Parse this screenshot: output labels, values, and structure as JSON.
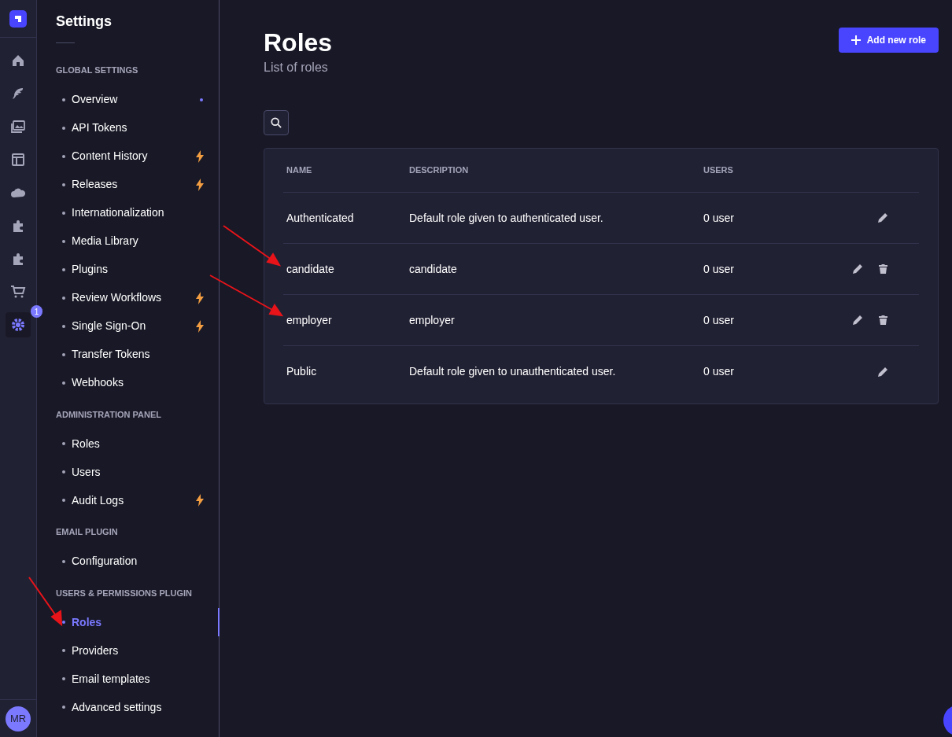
{
  "rail": {
    "items": [
      {
        "selected": false
      },
      {
        "selected": false
      },
      {
        "selected": false
      },
      {
        "selected": false
      },
      {
        "selected": false
      },
      {
        "selected": false
      },
      {
        "selected": false
      },
      {
        "selected": false
      },
      {
        "selected": true,
        "badge": "1"
      }
    ],
    "avatar": "MR"
  },
  "sidebar": {
    "title": "Settings",
    "sections": [
      {
        "heading": "GLOBAL SETTINGS",
        "items": [
          {
            "label": "Overview",
            "selected": false,
            "kind": "new"
          },
          {
            "label": "API Tokens",
            "selected": false
          },
          {
            "label": "Content History",
            "selected": false,
            "kind": "premium"
          },
          {
            "label": "Releases",
            "selected": false,
            "kind": "premium"
          },
          {
            "label": "Internationalization",
            "selected": false
          },
          {
            "label": "Media Library",
            "selected": false
          },
          {
            "label": "Plugins",
            "selected": false
          },
          {
            "label": "Review Workflows",
            "selected": false,
            "kind": "premium"
          },
          {
            "label": "Single Sign-On",
            "selected": false,
            "kind": "premium"
          },
          {
            "label": "Transfer Tokens",
            "selected": false
          },
          {
            "label": "Webhooks",
            "selected": false
          }
        ]
      },
      {
        "heading": "ADMINISTRATION PANEL",
        "items": [
          {
            "label": "Roles",
            "selected": false
          },
          {
            "label": "Users",
            "selected": false
          },
          {
            "label": "Audit Logs",
            "selected": false,
            "kind": "premium"
          }
        ]
      },
      {
        "heading": "EMAIL PLUGIN",
        "items": [
          {
            "label": "Configuration",
            "selected": false
          }
        ]
      },
      {
        "heading": "USERS & PERMISSIONS PLUGIN",
        "items": [
          {
            "label": "Roles",
            "selected": true
          },
          {
            "label": "Providers",
            "selected": false
          },
          {
            "label": "Email templates",
            "selected": false
          },
          {
            "label": "Advanced settings",
            "selected": false
          }
        ]
      }
    ]
  },
  "header": {
    "title": "Roles",
    "subtitle": "List of roles",
    "button": "Add new role"
  },
  "table": {
    "columns": [
      "NAME",
      "DESCRIPTION",
      "USERS"
    ],
    "rows": [
      {
        "name": "Authenticated",
        "description": "Default role given to authenticated user.",
        "users": "0 user",
        "deletable": false
      },
      {
        "name": "candidate",
        "description": "candidate",
        "users": "0 user",
        "deletable": true
      },
      {
        "name": "employer",
        "description": "employer",
        "users": "0 user",
        "deletable": true
      },
      {
        "name": "Public",
        "description": "Default role given to unauthenticated user.",
        "users": "0 user",
        "deletable": false
      }
    ]
  }
}
